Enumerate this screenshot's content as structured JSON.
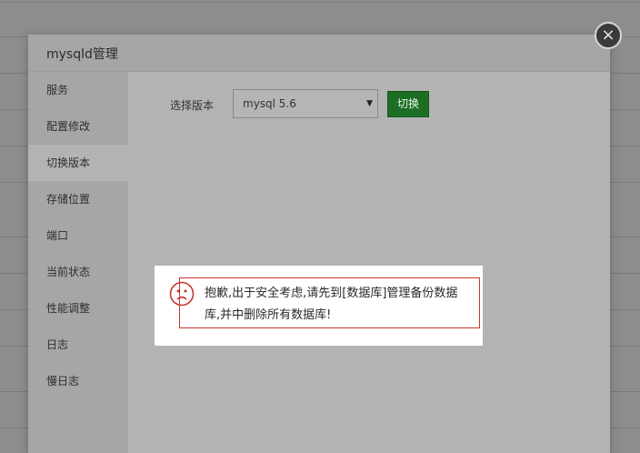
{
  "dialog": {
    "title": "mysqld管理",
    "close_symbol": "×"
  },
  "sidebar": {
    "items": [
      {
        "label": "服务"
      },
      {
        "label": "配置修改"
      },
      {
        "label": "切换版本"
      },
      {
        "label": "存储位置"
      },
      {
        "label": "端口"
      },
      {
        "label": "当前状态"
      },
      {
        "label": "性能调整"
      },
      {
        "label": "日志"
      },
      {
        "label": "慢日志"
      }
    ],
    "active": "切换版本"
  },
  "version": {
    "label": "选择版本",
    "selected": "mysql 5.6",
    "switch_label": "切换"
  },
  "toast": {
    "icon": "sad-face-icon",
    "message": "抱歉,出于安全考虑,请先到[数据库]管理备份数据库,并中删除所有数据库!",
    "color": "#c9352c"
  }
}
